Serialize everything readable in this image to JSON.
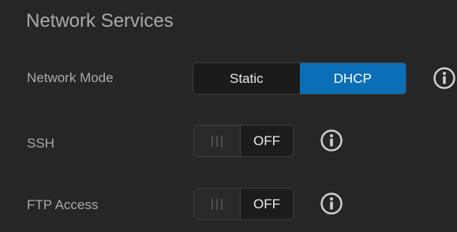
{
  "section": {
    "title": "Network Services"
  },
  "network_mode": {
    "label": "Network Mode",
    "options": [
      "Static",
      "DHCP"
    ],
    "selected": "DHCP",
    "accent_color": "#0b6fb8",
    "info_icon": "info-icon"
  },
  "ssh": {
    "label": "SSH",
    "state": "OFF",
    "info_icon": "info-icon"
  },
  "ftp": {
    "label": "FTP Access",
    "state": "OFF",
    "info_icon": "info-icon"
  }
}
